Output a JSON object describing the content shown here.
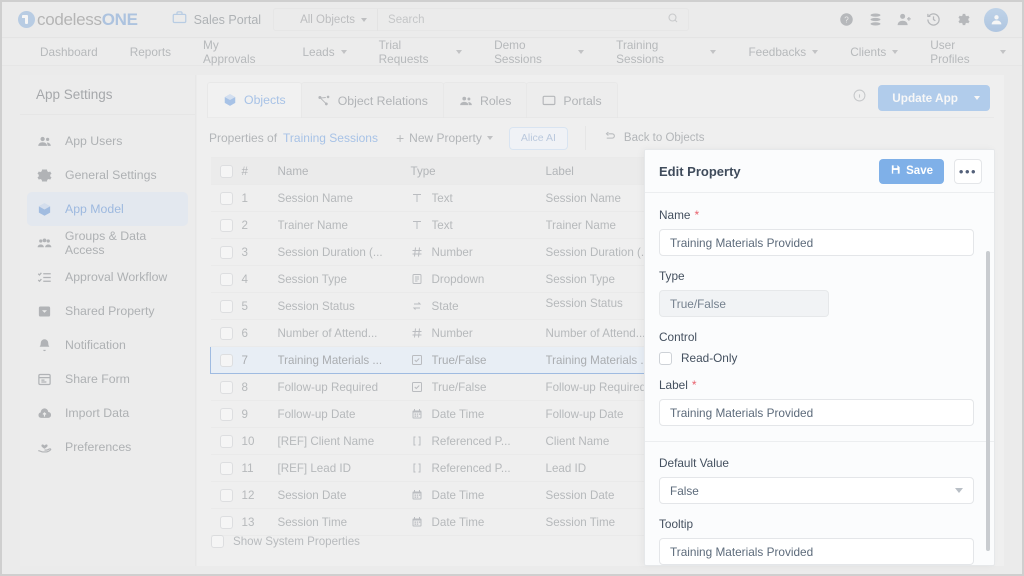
{
  "topbar": {
    "brand_prefix": "codeless",
    "brand_suffix": "ONE",
    "portal_name": "Sales Portal",
    "object_selector": "All Objects",
    "search_placeholder": "Search",
    "icons": [
      "help-circle-icon",
      "database-icon",
      "add-user-icon",
      "history-icon",
      "gear-icon",
      "avatar-icon"
    ]
  },
  "nav": {
    "items": [
      {
        "label": "Dashboard",
        "has_caret": false
      },
      {
        "label": "Reports",
        "has_caret": false
      },
      {
        "label": "My Approvals",
        "has_caret": false
      },
      {
        "label": "Leads",
        "has_caret": true
      },
      {
        "label": "Trial Requests",
        "has_caret": true
      },
      {
        "label": "Demo Sessions",
        "has_caret": true
      },
      {
        "label": "Training Sessions",
        "has_caret": true
      },
      {
        "label": "Feedbacks",
        "has_caret": true
      },
      {
        "label": "Clients",
        "has_caret": true
      },
      {
        "label": "User Profiles",
        "has_caret": true
      }
    ]
  },
  "sidebar": {
    "title": "App Settings",
    "items": [
      {
        "label": "App Users",
        "icon": "users-icon",
        "active": false
      },
      {
        "label": "General Settings",
        "icon": "gear-icon",
        "active": false
      },
      {
        "label": "App Model",
        "icon": "cube-icon",
        "active": true
      },
      {
        "label": "Groups & Data Access",
        "icon": "group-users-icon",
        "active": false
      },
      {
        "label": "Approval Workflow",
        "icon": "checklist-icon",
        "active": false
      },
      {
        "label": "Shared Property",
        "icon": "inbox-icon",
        "active": false
      },
      {
        "label": "Notification",
        "icon": "bell-icon",
        "active": false
      },
      {
        "label": "Share Form",
        "icon": "form-icon",
        "active": false
      },
      {
        "label": "Import Data",
        "icon": "cloud-upload-icon",
        "active": false
      },
      {
        "label": "Preferences",
        "icon": "hand-heart-icon",
        "active": false
      }
    ]
  },
  "main": {
    "tabs": [
      {
        "label": "Objects",
        "icon": "cube-icon",
        "active": true
      },
      {
        "label": "Object Relations",
        "icon": "relations-icon",
        "active": false
      },
      {
        "label": "Roles",
        "icon": "users-icon",
        "active": false
      },
      {
        "label": "Portals",
        "icon": "monitor-icon",
        "active": false
      }
    ],
    "update_button": "Update App",
    "info_icon": "info-icon",
    "props_bar": {
      "prefix": "Properties of",
      "object_name": "Training Sessions",
      "new_property": "New Property",
      "alice_ai": "Alice AI",
      "back_to_objects": "Back to Objects"
    },
    "table": {
      "columns": [
        "",
        "#",
        "Name",
        "Type",
        "Label"
      ],
      "rows": [
        {
          "num": "1",
          "name": "Session Name",
          "type": "Text",
          "type_icon": "text-icon",
          "label": "Session Name",
          "selected": false,
          "dot": false
        },
        {
          "num": "2",
          "name": "Trainer Name",
          "type": "Text",
          "type_icon": "text-icon",
          "label": "Trainer Name",
          "selected": false,
          "dot": false
        },
        {
          "num": "3",
          "name": "Session Duration (...",
          "type": "Number",
          "type_icon": "number-icon",
          "label": "Session Duration (...",
          "selected": false,
          "dot": false
        },
        {
          "num": "4",
          "name": "Session Type",
          "type": "Dropdown",
          "type_icon": "dropdown-icon",
          "label": "Session Type",
          "selected": false,
          "dot": false
        },
        {
          "num": "5",
          "name": "Session Status",
          "type": "State",
          "type_icon": "state-icon",
          "label": "Session Status",
          "selected": false,
          "dot": true
        },
        {
          "num": "6",
          "name": "Number of Attend...",
          "type": "Number",
          "type_icon": "number-icon",
          "label": "Number of Attend...",
          "selected": false,
          "dot": false
        },
        {
          "num": "7",
          "name": "Training Materials ...",
          "type": "True/False",
          "type_icon": "checkbox-icon",
          "label": "Training Materials ...",
          "selected": true,
          "dot": false
        },
        {
          "num": "8",
          "name": "Follow-up Required",
          "type": "True/False",
          "type_icon": "checkbox-icon",
          "label": "Follow-up Required",
          "selected": false,
          "dot": false
        },
        {
          "num": "9",
          "name": "Follow-up Date",
          "type": "Date Time",
          "type_icon": "calendar-icon",
          "label": "Follow-up Date",
          "selected": false,
          "dot": false
        },
        {
          "num": "10",
          "name": "[REF] Client Name",
          "type": "Referenced P...",
          "type_icon": "brackets-icon",
          "label": "Client Name",
          "selected": false,
          "dot": false
        },
        {
          "num": "11",
          "name": "[REF] Lead ID",
          "type": "Referenced P...",
          "type_icon": "brackets-icon",
          "label": "Lead ID",
          "selected": false,
          "dot": false
        },
        {
          "num": "12",
          "name": "Session Date",
          "type": "Date Time",
          "type_icon": "calendar-icon",
          "label": "Session Date",
          "selected": false,
          "dot": false
        },
        {
          "num": "13",
          "name": "Session Time",
          "type": "Date Time",
          "type_icon": "calendar-icon",
          "label": "Session Time",
          "selected": false,
          "dot": false
        }
      ]
    },
    "show_system_properties": "Show System Properties"
  },
  "edit_panel": {
    "title": "Edit Property",
    "save_label": "Save",
    "more_label": "•••",
    "fields": {
      "name_label": "Name",
      "name_value": "Training Materials Provided",
      "type_label": "Type",
      "type_value": "True/False",
      "control_label": "Control",
      "readonly_label": "Read-Only",
      "label_label": "Label",
      "label_value": "Training Materials Provided",
      "default_value_label": "Default Value",
      "default_value_value": "False",
      "tooltip_label": "Tooltip",
      "tooltip_value": "Training Materials Provided"
    }
  },
  "colors": {
    "accent": "#7fb0e8",
    "accent_text": "#6d9ee0",
    "required": "#e8616d",
    "status_dot": "#7fb0e8"
  }
}
